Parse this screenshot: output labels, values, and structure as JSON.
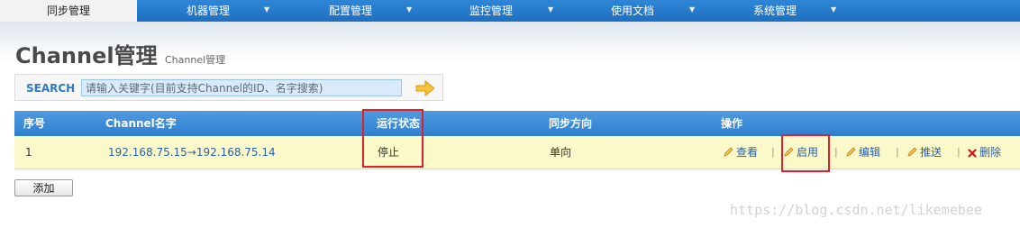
{
  "nav": {
    "items": [
      {
        "label": "同步管理",
        "active": true
      },
      {
        "label": "机器管理"
      },
      {
        "label": "配置管理"
      },
      {
        "label": "监控管理"
      },
      {
        "label": "使用文档"
      },
      {
        "label": "系统管理"
      }
    ],
    "arrow": "▼"
  },
  "page": {
    "title": "Channel管理",
    "subtitle": "Channel管理"
  },
  "search": {
    "label": "SEARCH",
    "placeholder": "请输入关键字(目前支持Channel的ID、名字搜索)",
    "value": ""
  },
  "table": {
    "headers": [
      "序号",
      "Channel名字",
      "运行状态",
      "同步方向",
      "操作"
    ],
    "rows": [
      {
        "index": "1",
        "name": "192.168.75.15→192.168.75.14",
        "status": "停止",
        "direction": "单向",
        "actions": {
          "view": "查看",
          "enable": "启用",
          "edit": "编辑",
          "push": "推送",
          "delete": "删除"
        },
        "separator": "|"
      }
    ]
  },
  "buttons": {
    "add": "添加"
  },
  "watermark": "https://blog.csdn.net/likemebee",
  "colors": {
    "nav": "#2b7fd0",
    "header_row": "#3d8dd8",
    "row_highlight": "#fbf9c9",
    "annotation": "#e0202a"
  }
}
